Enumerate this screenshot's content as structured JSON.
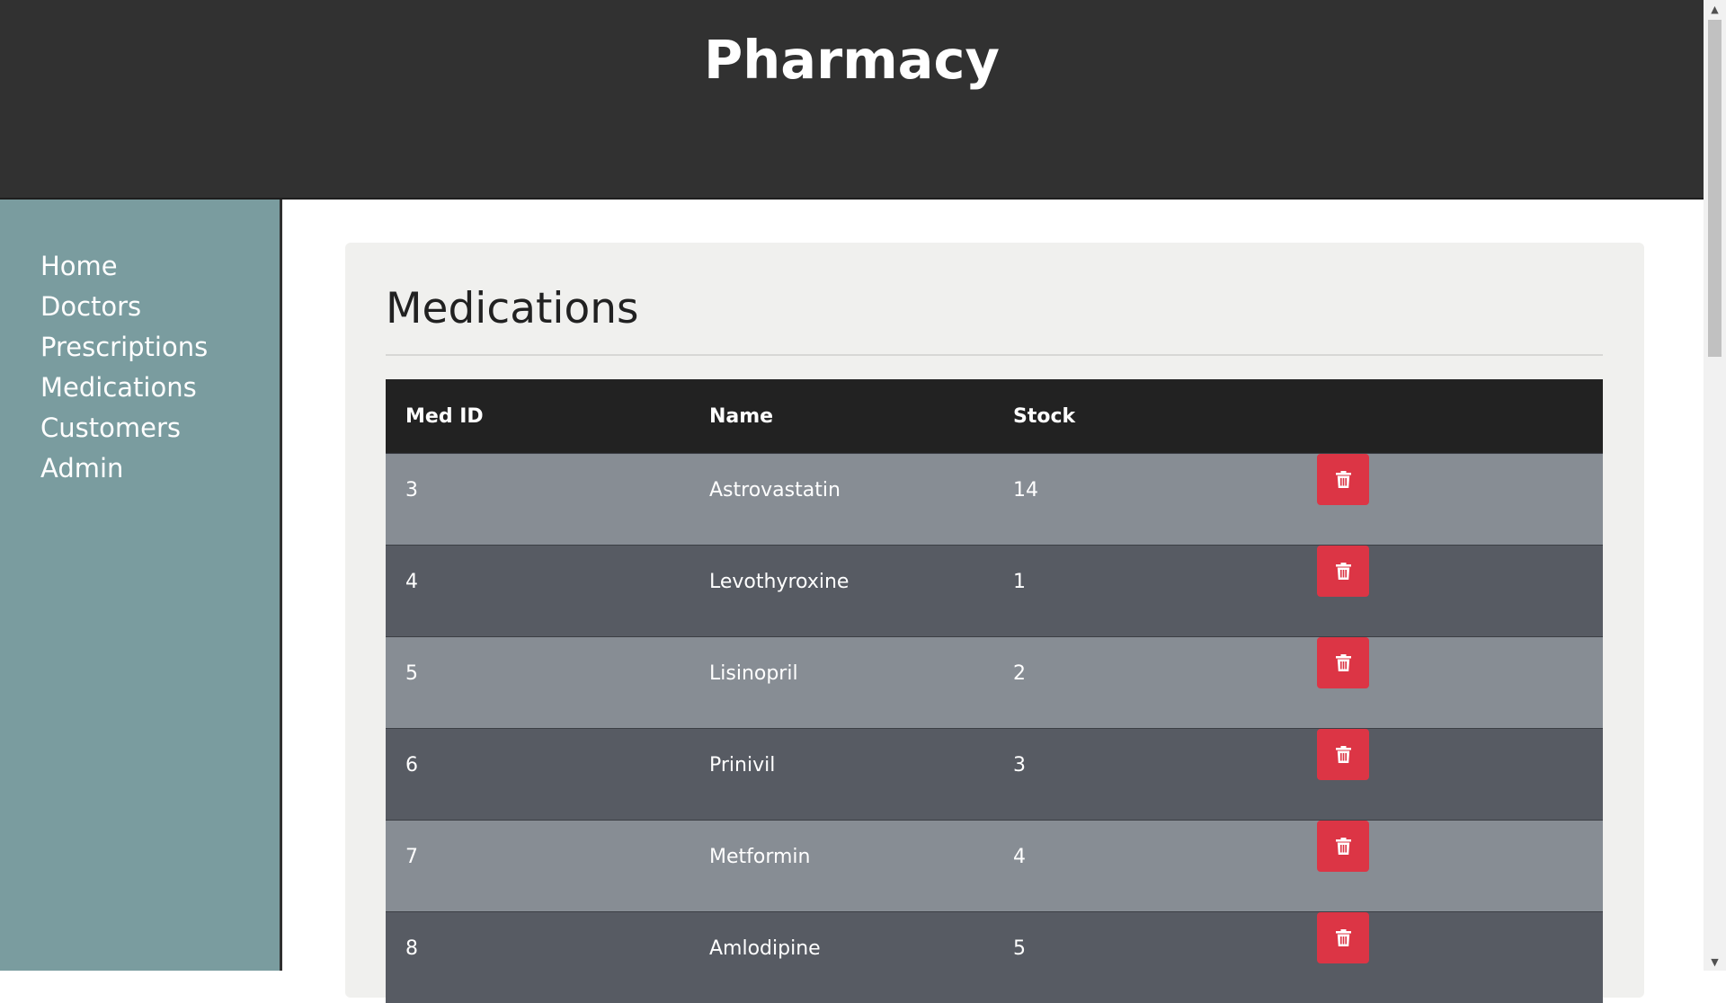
{
  "header": {
    "title": "Pharmacy"
  },
  "sidebar": {
    "items": [
      {
        "label": "Home"
      },
      {
        "label": "Doctors"
      },
      {
        "label": "Prescriptions"
      },
      {
        "label": "Medications"
      },
      {
        "label": "Customers"
      },
      {
        "label": "Admin"
      }
    ]
  },
  "main": {
    "title": "Medications",
    "table": {
      "columns": [
        "Med ID",
        "Name",
        "Stock",
        ""
      ],
      "rows": [
        {
          "id": "3",
          "name": "Astrovastatin",
          "stock": "14"
        },
        {
          "id": "4",
          "name": "Levothyroxine",
          "stock": "1"
        },
        {
          "id": "5",
          "name": "Lisinopril",
          "stock": "2"
        },
        {
          "id": "6",
          "name": "Prinivil",
          "stock": "3"
        },
        {
          "id": "7",
          "name": "Metformin",
          "stock": "4"
        },
        {
          "id": "8",
          "name": "Amlodipine",
          "stock": "5"
        }
      ],
      "row_action_icon": "trash-icon"
    }
  },
  "colors": {
    "header_bg": "#313131",
    "sidebar_bg": "#7a9c9f",
    "table_header_bg": "#222222",
    "row_light": "#878d94",
    "row_dark": "#575b63",
    "delete_button": "#dc3545"
  }
}
